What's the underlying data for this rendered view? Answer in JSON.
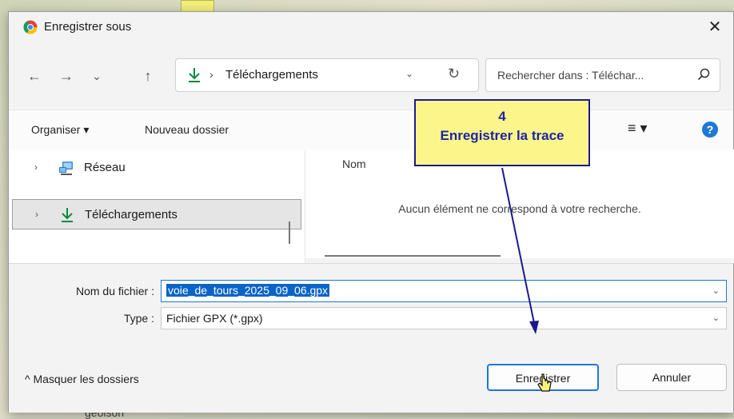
{
  "window": {
    "title": "Enregistrer sous",
    "close_symbol": "✕"
  },
  "nav": {
    "back_symbol": "←",
    "forward_symbol": "→",
    "recent_symbol": "⌄",
    "up_symbol": "↑",
    "address_separator": "›",
    "address_location": "Téléchargements",
    "address_dropdown_symbol": "⌄",
    "refresh_symbol": "↻",
    "search_placeholder": "Rechercher dans : Téléchar..."
  },
  "toolbar": {
    "organize_label": "Organiser ▾",
    "new_folder_label": "Nouveau dossier",
    "view_label": "≡ ▾",
    "help_label": "?"
  },
  "sidebar": {
    "items": [
      {
        "label": "Réseau",
        "chevron": "›"
      },
      {
        "label": "Téléchargements",
        "chevron": "›"
      }
    ]
  },
  "content": {
    "column_name": "Nom",
    "empty_message": "Aucun élément ne correspond à votre recherche."
  },
  "form": {
    "filename_label": "Nom du fichier :",
    "filename_value": "voie_de_tours_2025_09_06.gpx",
    "type_label": "Type :",
    "type_value": "Fichier GPX (*.gpx)",
    "dropdown_symbol": "⌄"
  },
  "footer": {
    "hide_folders_label": "^ Masquer les dossiers",
    "save_label": "Enregistrer",
    "cancel_label": "Annuler"
  },
  "annotation": {
    "step_number": "4",
    "step_text": "Enregistrer la trace"
  },
  "background": {
    "bottom_text": "geoison"
  },
  "colors": {
    "accent": "#1e78d4",
    "callout_fill": "#fcf68a",
    "callout_text": "#1d24a8"
  }
}
